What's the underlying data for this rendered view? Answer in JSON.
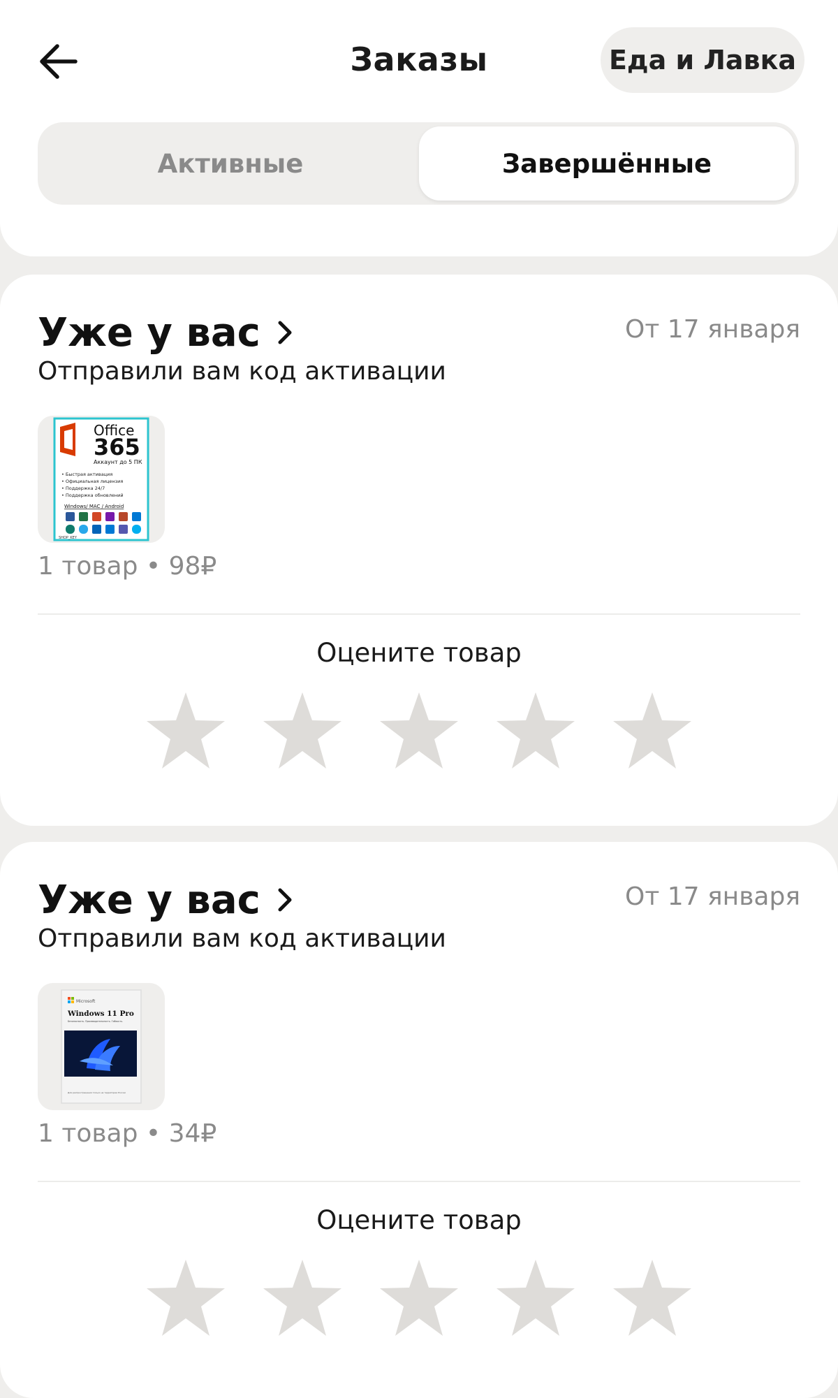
{
  "header": {
    "title": "Заказы",
    "service_button": "Еда и Лавка"
  },
  "tabs": [
    {
      "label": "Активные",
      "selected": false
    },
    {
      "label": "Завершённые",
      "selected": true
    }
  ],
  "orders": [
    {
      "status": "Уже у вас",
      "date": "От 17 января",
      "subtitle": "Отправили вам код активации",
      "summary": "1 товар • 98₽",
      "rating_label": "Оцените товар",
      "rating": 0,
      "product": {
        "icon": "office-365-box-image",
        "title_line1": "Office",
        "title_line2": "365",
        "tagline": "Аккаунт до 5 ПК",
        "features": [
          "• Быстрая активация",
          "• Официальная лицензия",
          "• Поддержка 24/7",
          "• Поддержка обновлений"
        ],
        "platforms": "Windows/ MAC / Android",
        "seller": "SHOP_KEY"
      }
    },
    {
      "status": "Уже у вас",
      "date": "От 17 января",
      "subtitle": "Отправили вам код активации",
      "summary": "1 товар • 34₽",
      "rating_label": "Оцените товар",
      "rating": 0,
      "product": {
        "icon": "windows-11-pro-box-image",
        "brand": "Microsoft",
        "title": "Windows 11 Pro",
        "tagline": "Безопасность. Производительность. Гибкость.",
        "footer": "Для распространения только на территории России"
      }
    }
  ],
  "colors": {
    "background": "#efeeec",
    "card": "#ffffff",
    "muted_text": "#8a8a8a",
    "star_empty": "#dedcd9",
    "office_border": "#2cc4cf",
    "office_red": "#d83b01"
  }
}
